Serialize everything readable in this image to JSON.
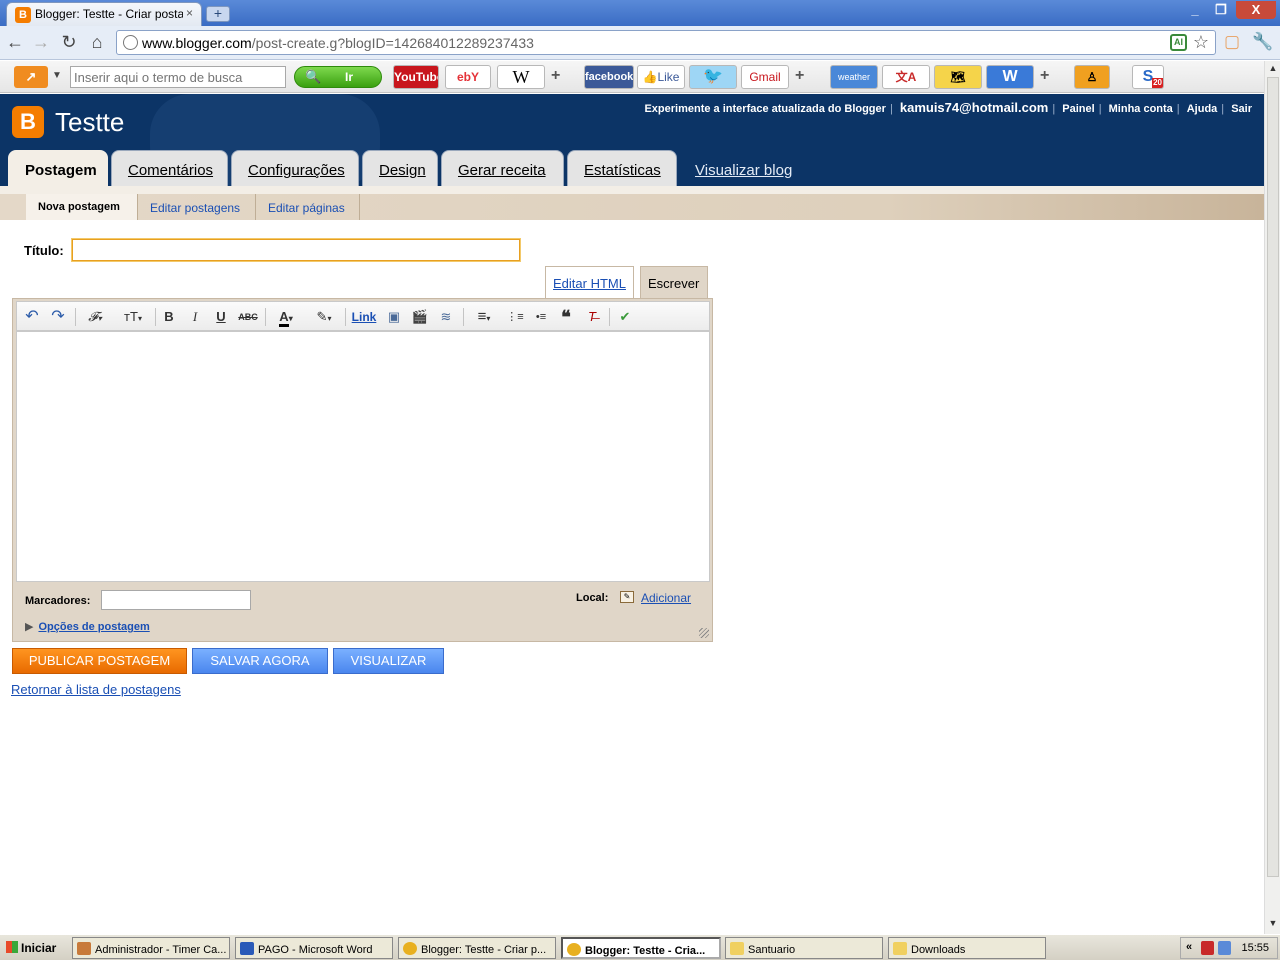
{
  "browser": {
    "tab_title": "Blogger: Testte - Criar postagem",
    "tab_close": "×",
    "new_tab": "+",
    "window_controls": {
      "minimize": "_",
      "maximize": "❐",
      "close": "X"
    },
    "url_host": "www.blogger.com",
    "url_path": "/post-create.g?blogID=142684012289237433"
  },
  "search_toolbar": {
    "logo": "↗",
    "placeholder": "Inserir aqui o termo de busca",
    "go_label": "Ir",
    "go_icon": "🔍",
    "plus": "+",
    "chips": {
      "youtube": "YouTube",
      "ebay": "ebY",
      "wiki": "W",
      "facebook": "facebook",
      "like": "👍Like",
      "gmail": "Gmail",
      "weather": "weather",
      "word": "W",
      "s_badge": "20"
    }
  },
  "blogger": {
    "blog_name": "Testte",
    "logo_letter": "B",
    "top_links": {
      "try_new": "Experimente a interface atualizada do Blogger",
      "email": "kamuis74@hotmail.com",
      "dashboard": "Painel",
      "account": "Minha conta",
      "help": "Ajuda",
      "signout": "Sair"
    },
    "tabs": [
      "Postagem",
      "Comentários",
      "Configurações",
      "Design",
      "Gerar receita",
      "Estatísticas"
    ],
    "view_blog": "Visualizar blog",
    "subtabs": [
      "Nova postagem",
      "Editar postagens",
      "Editar páginas"
    ],
    "title_label": "Título:",
    "title_value": "",
    "mode_html": "Editar HTML",
    "mode_write": "Escrever",
    "toolbar": {
      "undo": "↶",
      "redo": "↷",
      "font": "𝓕",
      "size": "тT",
      "bold": "B",
      "italic": "I",
      "underline": "U",
      "strike": "ABC",
      "color": "A",
      "highlight": "✎",
      "link": "Link",
      "image": "▣",
      "video": "🎬",
      "break": "≋",
      "align": "≡",
      "ol": "⋮≡",
      "ul": "•≡",
      "quote": "❝",
      "clear": "T̶",
      "spell": "✔",
      "dropdown": "▾"
    },
    "labels_label": "Marcadores:",
    "labels_value": "",
    "location_label": "Local:",
    "location_add": "Adicionar",
    "options_toggle": "▶",
    "options_link": "Opções de postagem",
    "publish": "PUBLICAR POSTAGEM",
    "save": "SALVAR AGORA",
    "preview": "VISUALIZAR",
    "return_link": "Retornar à lista de postagens"
  },
  "taskbar": {
    "start": "Iniciar",
    "items": [
      "Administrador - Timer Ca...",
      "PAGO - Microsoft Word",
      "Blogger: Testte - Criar p...",
      "Blogger: Testte - Cria...",
      "Santuario",
      "Downloads"
    ],
    "tray_chevron": "«",
    "clock": "15:55"
  }
}
